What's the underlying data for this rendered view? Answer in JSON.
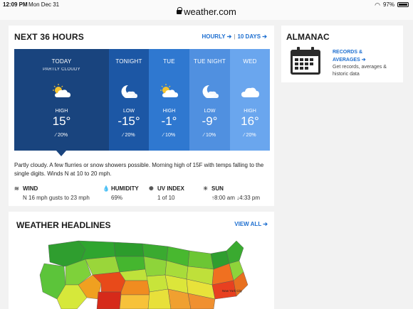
{
  "status": {
    "time": "12:09 PM",
    "date": "Mon Dec 31",
    "battery": "97%",
    "url": "weather.com"
  },
  "forecast": {
    "title": "NEXT 36 HOURS",
    "links": {
      "hourly": "HOURLY",
      "ten_days": "10 DAYS"
    },
    "periods": [
      {
        "label": "TODAY",
        "sub": "PARTLY CLOUDY",
        "hl": "HIGH",
        "temp": "15°",
        "precip": "20%",
        "icon": "partly-cloudy-day-icon",
        "color": "#19447e"
      },
      {
        "label": "TONIGHT",
        "sub": "",
        "hl": "LOW",
        "temp": "-15°",
        "precip": "20%",
        "icon": "partly-cloudy-night-icon",
        "color": "#1c57a5"
      },
      {
        "label": "TUE",
        "sub": "",
        "hl": "HIGH",
        "temp": "-1°",
        "precip": "10%",
        "icon": "partly-cloudy-day-icon",
        "color": "#2f78d0"
      },
      {
        "label": "TUE NIGHT",
        "sub": "",
        "hl": "LOW",
        "temp": "-9°",
        "precip": "10%",
        "icon": "partly-cloudy-night-icon",
        "color": "#5090e0"
      },
      {
        "label": "WED",
        "sub": "",
        "hl": "HIGH",
        "temp": "16°",
        "precip": "20%",
        "icon": "cloudy-icon",
        "color": "#6aa6ee"
      }
    ],
    "narrative": "Partly cloudy. A few flurries or snow showers possible. Morning high of 15F with temps falling to the single digits. Winds N at 10 to 20 mph.",
    "details": {
      "wind_label": "WIND",
      "wind_value": "N 16 mph gusts to 23 mph",
      "humidity_label": "HUMIDITY",
      "humidity_value": "69%",
      "uv_label": "UV INDEX",
      "uv_value": "1 of 10",
      "sun_label": "SUN",
      "sunrise": "8:00 am",
      "sunset": "4:33 pm"
    }
  },
  "almanac": {
    "title": "ALMANAC",
    "link_line1": "RECORDS &",
    "link_line2": "AVERAGES",
    "desc": "Get records, averages & historic data"
  },
  "headlines": {
    "title": "WEATHER HEADLINES",
    "view_all": "VIEW ALL",
    "map_label": "New York City"
  },
  "colors": {
    "accent": "#1e6fd0",
    "period_today": "#19447e",
    "period_tonight": "#1c57a5",
    "period_tue": "#2f78d0",
    "period_tue_night": "#5090e0",
    "period_wed": "#6aa6ee"
  }
}
